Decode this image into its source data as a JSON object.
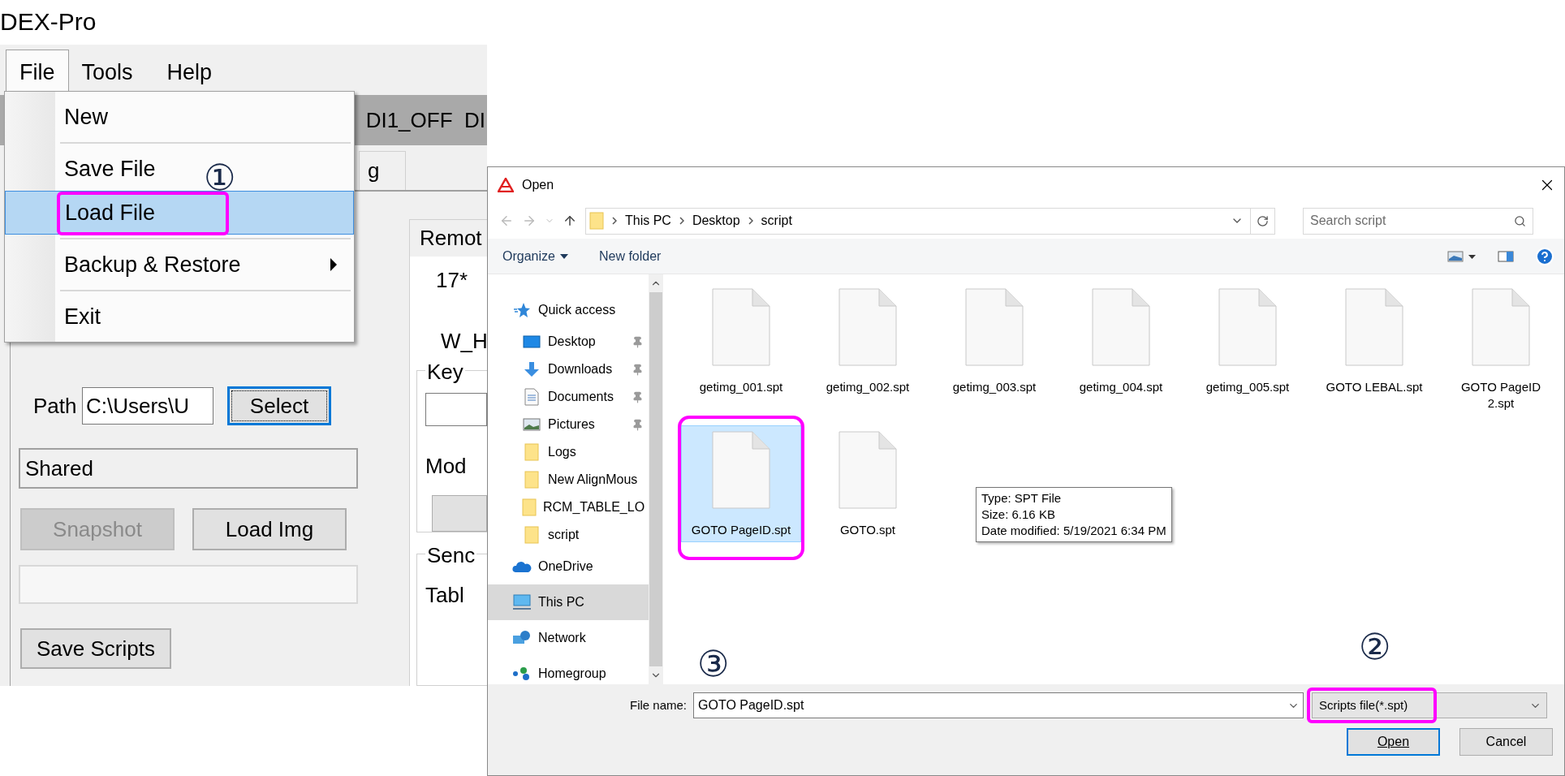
{
  "app": {
    "title": "DEX-Pro",
    "menu_bar": [
      {
        "label": "File",
        "selected": true
      },
      {
        "label": "Tools",
        "selected": false
      },
      {
        "label": "Help",
        "selected": false
      }
    ],
    "toolbar_text": "DI1_OFF  DI",
    "tab_fragment": "g",
    "file_menu": [
      {
        "kind": "item",
        "label": "New",
        "highlighted": false
      },
      {
        "kind": "separator"
      },
      {
        "kind": "item",
        "label": "Save File",
        "highlighted": false
      },
      {
        "kind": "item",
        "label": "Load File",
        "highlighted": true,
        "outlined": true,
        "marker": "①"
      },
      {
        "kind": "separator"
      },
      {
        "kind": "submenu",
        "label": "Backup & Restore",
        "highlighted": false
      },
      {
        "kind": "separator"
      },
      {
        "kind": "item",
        "label": "Exit",
        "highlighted": false
      }
    ],
    "path": {
      "label": "Path",
      "value": "C:\\Users\\U"
    },
    "select_button": {
      "label": "Select",
      "focused": true
    },
    "shared_field": {
      "value": "Shared"
    },
    "buttons": [
      {
        "label": "Snapshot",
        "disabled": true
      },
      {
        "label": "Load Img",
        "disabled": false
      }
    ],
    "save_scripts_button": {
      "label": "Save Scripts"
    },
    "side_panel": {
      "tab": "Remot",
      "reading": "17*",
      "label_1": "W_H",
      "group_1": "Key",
      "label_2": "Mod",
      "group_2": "Senc",
      "label_3": "Tabl"
    }
  },
  "dialog": {
    "title": "Open",
    "breadcrumb": [
      "This PC",
      "Desktop",
      "script"
    ],
    "search": {
      "placeholder": "Search script"
    },
    "toolbar": [
      {
        "label": "Organize",
        "dropdown": true
      },
      {
        "label": "New folder",
        "dropdown": false
      }
    ],
    "nav": [
      {
        "label": "Quick access",
        "kind": "star",
        "selected": false,
        "children": [
          {
            "label": "Desktop",
            "kind": "desktop",
            "pinned": true,
            "selected": false
          },
          {
            "label": "Downloads",
            "kind": "download",
            "pinned": true,
            "selected": false
          },
          {
            "label": "Documents",
            "kind": "document",
            "pinned": true,
            "selected": false
          },
          {
            "label": "Pictures",
            "kind": "pictures",
            "pinned": true,
            "selected": false
          },
          {
            "label": "Logs",
            "kind": "folder",
            "pinned": false,
            "selected": false
          },
          {
            "label": "New AlignMous",
            "kind": "folder",
            "pinned": false,
            "selected": false
          },
          {
            "label": "RCM_TABLE_LO",
            "kind": "folder",
            "pinned": false,
            "selected": false
          },
          {
            "label": "script",
            "kind": "folder",
            "pinned": false,
            "selected": false
          }
        ]
      },
      {
        "label": "OneDrive",
        "kind": "cloud",
        "selected": false
      },
      {
        "label": "This PC",
        "kind": "pc",
        "selected": true
      },
      {
        "label": "Network",
        "kind": "network",
        "selected": false
      },
      {
        "label": "Homegroup",
        "kind": "homegroup",
        "selected": false
      }
    ],
    "files": [
      {
        "name": "getimg_001.spt",
        "selected": false
      },
      {
        "name": "getimg_002.spt",
        "selected": false
      },
      {
        "name": "getimg_003.spt",
        "selected": false
      },
      {
        "name": "getimg_004.spt",
        "selected": false
      },
      {
        "name": "getimg_005.spt",
        "selected": false
      },
      {
        "name": "GOTO LEBAL.spt",
        "selected": false
      },
      {
        "name": "GOTO PageID 2.spt",
        "selected": false
      },
      {
        "name": "GOTO PageID.spt",
        "selected": true,
        "outlined": true
      },
      {
        "name": "GOTO.spt",
        "selected": false
      }
    ],
    "tooltip": [
      "Type: SPT File",
      "Size: 6.16 KB",
      "Date modified: 5/19/2021 6:34 PM"
    ],
    "file_name": {
      "label": "File name:",
      "value": "GOTO PageID.spt",
      "marker": "③"
    },
    "filter": {
      "value": "Scripts file(*.spt)",
      "outlined": true,
      "marker": "②"
    },
    "buttons": [
      {
        "label": "Open",
        "default": true
      },
      {
        "label": "Cancel",
        "default": false
      }
    ]
  }
}
